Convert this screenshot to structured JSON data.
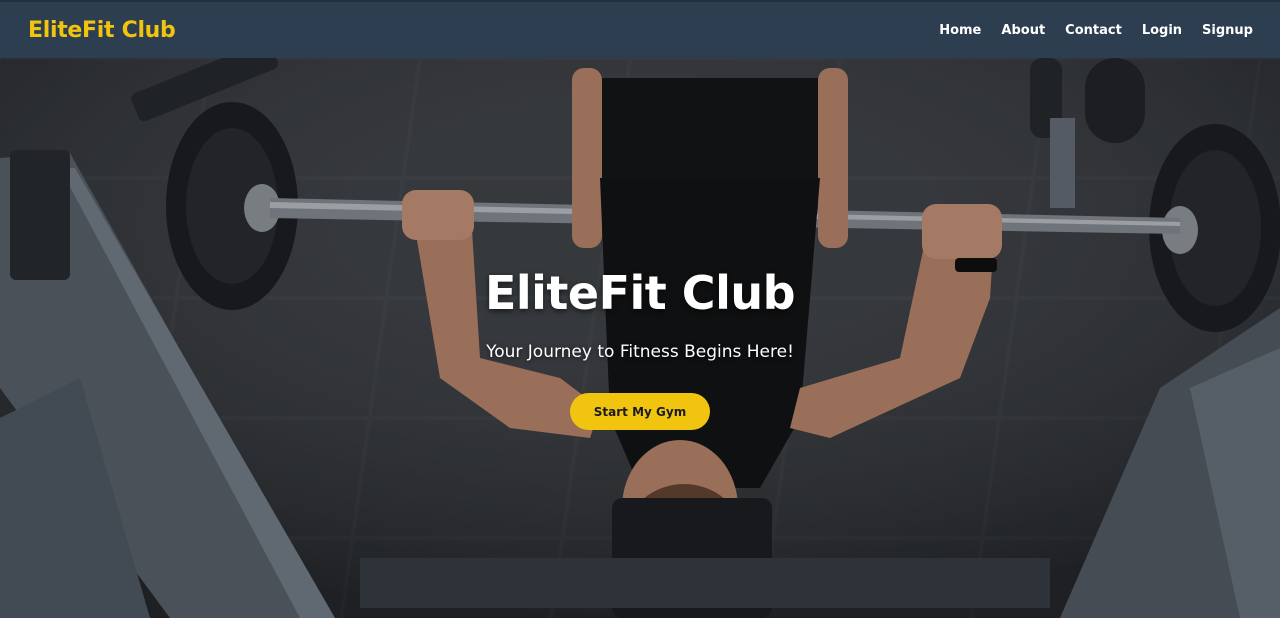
{
  "nav": {
    "brand": "EliteFit Club",
    "links": [
      "Home",
      "About",
      "Contact",
      "Login",
      "Signup"
    ]
  },
  "hero": {
    "title": "EliteFit Club",
    "subtitle": "Your Journey to Fitness Begins Here!",
    "cta_label": "Start My Gym",
    "image_alt": "photo-man-bench-press"
  },
  "colors": {
    "nav_bg": "#2c3e50",
    "accent": "#f1c40f",
    "nav_text": "#ffffff"
  }
}
